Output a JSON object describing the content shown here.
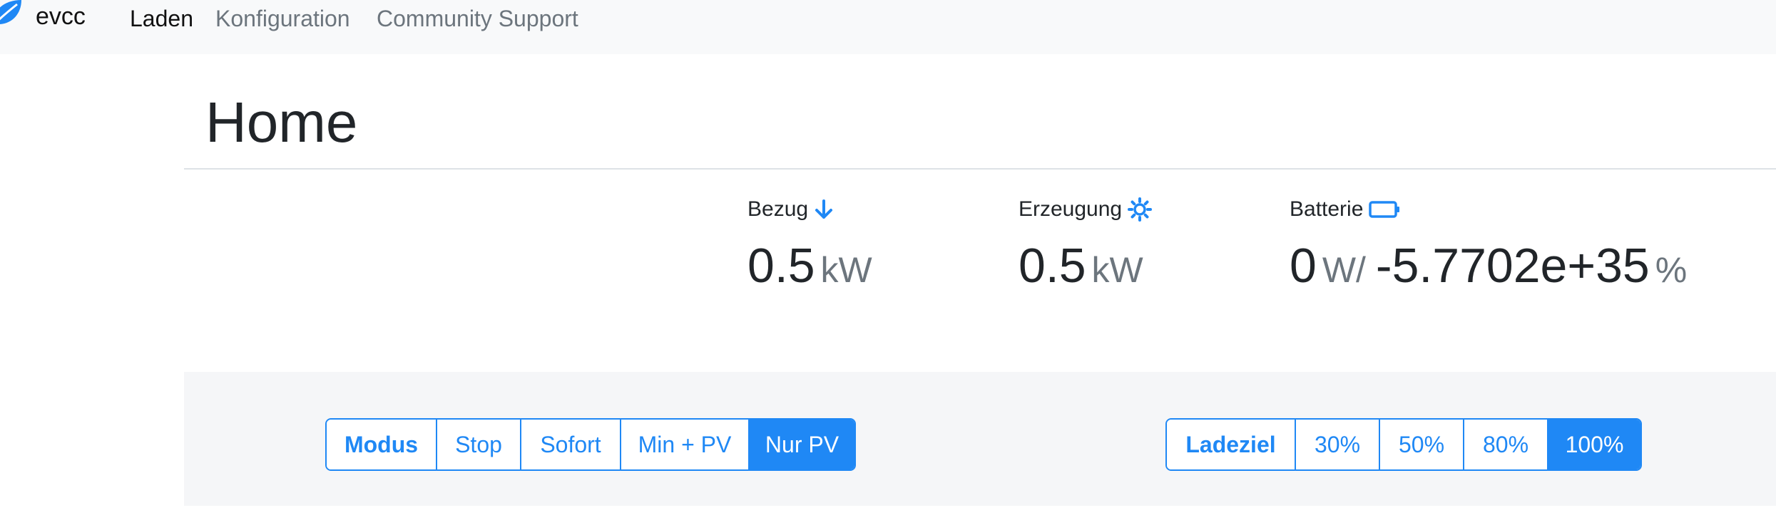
{
  "navbar": {
    "brand": "evcc",
    "links": [
      "Laden",
      "Konfiguration",
      "Community Support"
    ]
  },
  "site": {
    "title": "Home"
  },
  "stats": {
    "bezug": {
      "label": "Bezug",
      "value": "0.5",
      "unit": "kW",
      "icon": "arrow-down-icon"
    },
    "erzeugung": {
      "label": "Erzeugung",
      "value": "0.5",
      "unit": "kW",
      "icon": "sun-icon"
    },
    "batterie": {
      "label": "Batterie",
      "value": "0",
      "unit": "W/",
      "soc": "-5.7702e+35",
      "soc_unit": "%",
      "icon": "battery-icon"
    }
  },
  "mode": {
    "label": "Modus",
    "options": [
      "Stop",
      "Sofort",
      "Min + PV",
      "Nur PV"
    ],
    "selected": "Nur PV"
  },
  "target": {
    "label": "Ladeziel",
    "options": [
      "30%",
      "50%",
      "80%",
      "100%"
    ],
    "selected": "100%"
  },
  "colors": {
    "accent": "#1f88f5",
    "panel": "#f5f6f8",
    "navbar": "#f8f9fa"
  }
}
